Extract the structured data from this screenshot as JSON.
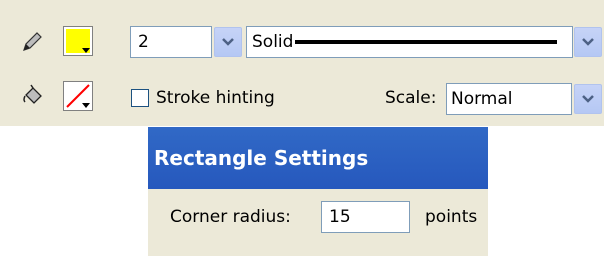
{
  "properties": {
    "stroke_width": "2",
    "stroke_style": "Solid",
    "stroke_hinting_label": "Stroke hinting",
    "stroke_hinting_checked": false,
    "scale_label": "Scale:",
    "scale_value": "Normal",
    "stroke_color": "#ffff00",
    "fill_color": "none",
    "icons": [
      "pencil-icon",
      "paint-bucket-icon",
      "no-color-icon",
      "chevron-down-icon"
    ]
  },
  "rectangle_settings": {
    "title": "Rectangle Settings",
    "corner_radius_label": "Corner radius:",
    "corner_radius_value": "15",
    "unit_label": "points"
  }
}
